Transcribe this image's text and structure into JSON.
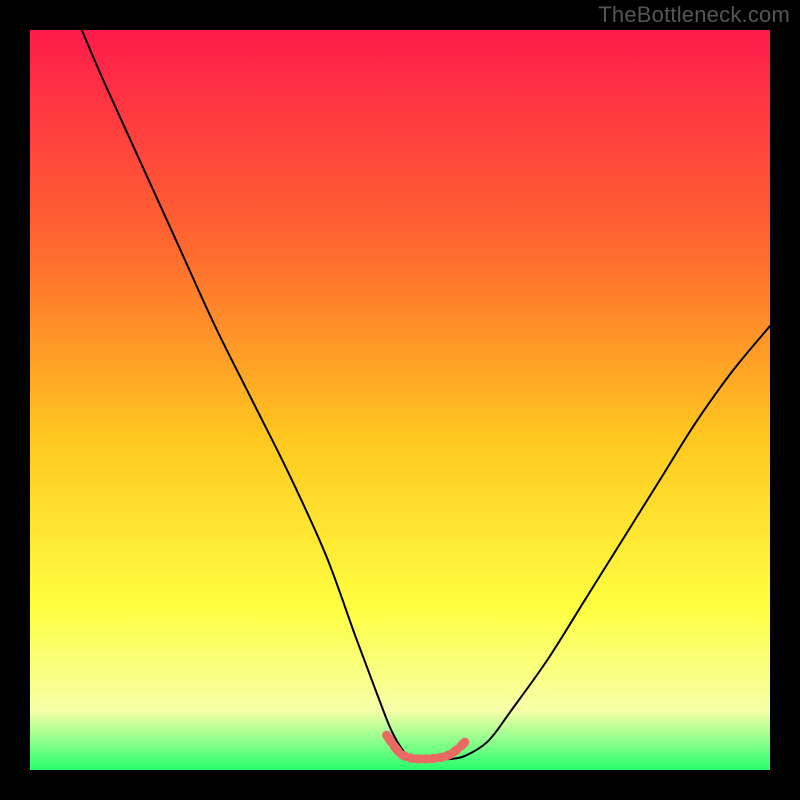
{
  "watermark": "TheBottleneck.com",
  "colors": {
    "bg": "#000000",
    "grad_top": "#ff1b4a",
    "grad_mid1": "#ff6a2f",
    "grad_mid2": "#ffc71f",
    "grad_mid3": "#ffff40",
    "grad_mid4": "#f6ffa8",
    "grad_bottom": "#28ff6e",
    "curve": "#000000",
    "marker": "#e96a62"
  },
  "chart_data": {
    "type": "line",
    "title": "",
    "xlabel": "",
    "ylabel": "",
    "xlim": [
      0,
      100
    ],
    "ylim": [
      0,
      100
    ],
    "series": [
      {
        "name": "bottleneck-curve",
        "x": [
          7,
          10,
          15,
          20,
          25,
          30,
          35,
          40,
          44,
          47,
          49,
          51,
          53,
          55,
          57,
          59,
          62,
          65,
          70,
          75,
          80,
          85,
          90,
          95,
          100
        ],
        "y": [
          100,
          93,
          82,
          71,
          60,
          50,
          40,
          29,
          18,
          10,
          5,
          2,
          1.5,
          1.5,
          1.5,
          2,
          4,
          8,
          15,
          23,
          31,
          39,
          47,
          54,
          60
        ]
      }
    ],
    "annotations": [
      {
        "name": "valley-marker",
        "type": "dotted-segment",
        "x": [
          48,
          49,
          50,
          51,
          52,
          53,
          54,
          55,
          56,
          57,
          58,
          59
        ],
        "y": [
          5,
          3.5,
          2.2,
          1.7,
          1.5,
          1.5,
          1.5,
          1.6,
          1.8,
          2.2,
          3,
          4
        ]
      }
    ]
  }
}
